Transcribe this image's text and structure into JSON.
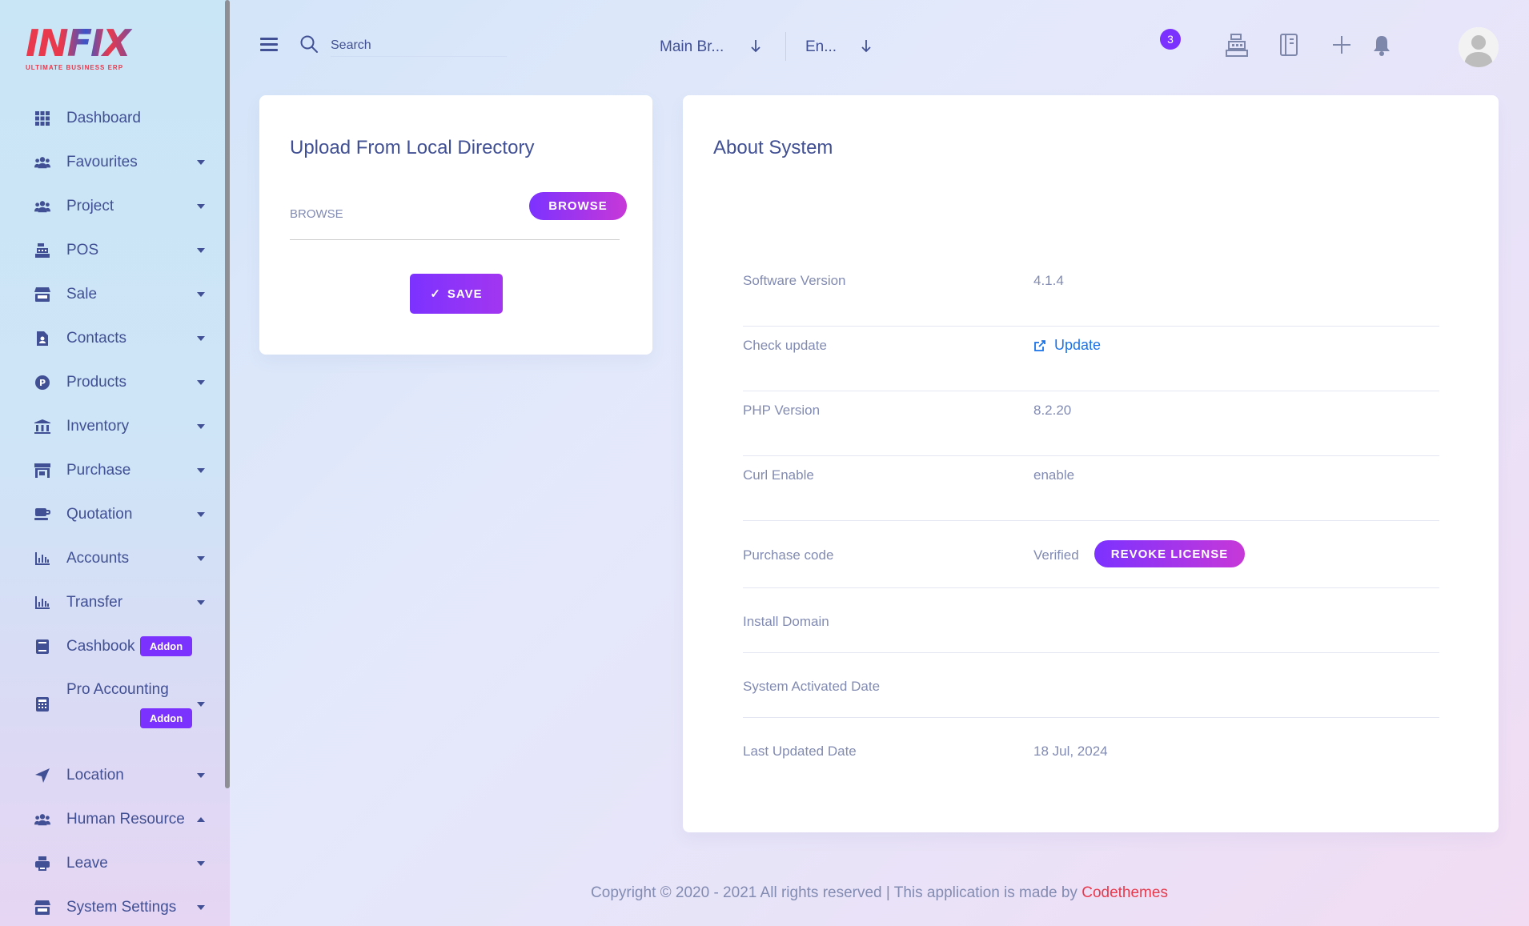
{
  "brand": {
    "logo_text": "INFIX",
    "tagline": "ULTIMATE BUSINESS ERP"
  },
  "sidebar": {
    "items": [
      {
        "label": "Dashboard",
        "icon": "grid-icon",
        "caret": "none"
      },
      {
        "label": "Favourites",
        "icon": "users-icon",
        "caret": "down"
      },
      {
        "label": "Project",
        "icon": "users-icon",
        "caret": "down"
      },
      {
        "label": "POS",
        "icon": "cash-register-icon",
        "caret": "down"
      },
      {
        "label": "Sale",
        "icon": "store-icon",
        "caret": "down"
      },
      {
        "label": "Contacts",
        "icon": "contact-file-icon",
        "caret": "down"
      },
      {
        "label": "Products",
        "icon": "product-p-icon",
        "caret": "down"
      },
      {
        "label": "Inventory",
        "icon": "bank-icon",
        "caret": "down"
      },
      {
        "label": "Purchase",
        "icon": "shop-icon",
        "caret": "down"
      },
      {
        "label": "Quotation",
        "icon": "coffee-mug-icon",
        "caret": "down"
      },
      {
        "label": "Accounts",
        "icon": "bar-chart-icon",
        "caret": "down"
      },
      {
        "label": "Transfer",
        "icon": "bar-chart-icon",
        "caret": "down"
      },
      {
        "label": "Cashbook",
        "icon": "book-icon",
        "caret": "none",
        "badge": "Addon"
      },
      {
        "label": "Pro Accounting",
        "icon": "calculator-icon",
        "caret": "down",
        "badge": "Addon"
      },
      {
        "label": "Location",
        "icon": "location-arrow-icon",
        "caret": "down"
      },
      {
        "label": "Human Resource",
        "icon": "users-icon",
        "caret": "up"
      },
      {
        "label": "Leave",
        "icon": "printer-icon",
        "caret": "down"
      },
      {
        "label": "System Settings",
        "icon": "store-icon",
        "caret": "down"
      }
    ]
  },
  "topbar": {
    "search_placeholder": "Search",
    "branch_select": "Main Br...",
    "language_select": "En...",
    "notification_count": "3",
    "icons": [
      "cash-register-icon",
      "notebook-icon",
      "plus-icon",
      "bell-icon",
      "user-avatar-icon"
    ]
  },
  "upload_card": {
    "title": "Upload From Local Directory",
    "browse_placeholder": "BROWSE",
    "browse_button": "BROWSE",
    "save_button": "SAVE"
  },
  "about_card": {
    "title": "About System",
    "rows": [
      {
        "key": "Software Version",
        "value": "4.1.4"
      },
      {
        "key": "Check update",
        "value": "Update"
      },
      {
        "key": "PHP Version",
        "value": "8.2.20"
      },
      {
        "key": "Curl Enable",
        "value": "enable"
      },
      {
        "key": "Purchase code",
        "value": "Verified",
        "button": "REVOKE LICENSE"
      },
      {
        "key": "Install Domain",
        "value": ""
      },
      {
        "key": "System Activated Date",
        "value": ""
      },
      {
        "key": "Last Updated Date",
        "value": "18 Jul, 2024"
      }
    ]
  },
  "footer": {
    "text": "Copyright © 2020 - 2021 All rights reserved | This application is made by",
    "link": "Codethemes"
  },
  "colors": {
    "accent": "#7c32ff",
    "accent_end": "#c738d8",
    "text": "#415094",
    "muted": "#828bb2",
    "link": "#1a73e8",
    "brand_red": "#e8394d"
  }
}
